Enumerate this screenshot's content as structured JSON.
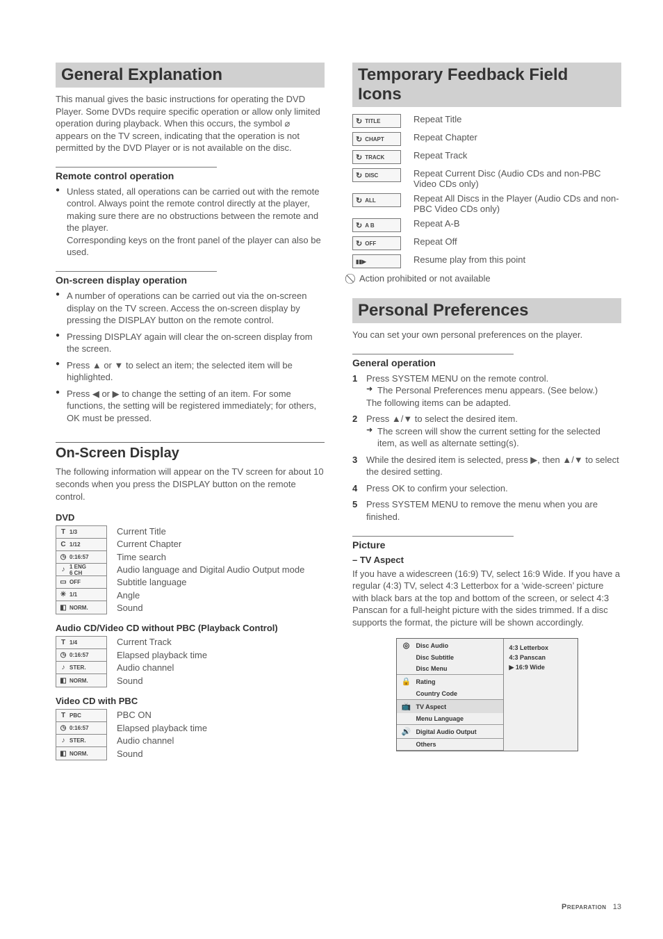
{
  "left": {
    "h1": "General Explanation",
    "intro": "This manual gives the basic instructions for operating the DVD Player. Some DVDs require specific operation or allow only limited operation during playback. When this occurs, the symbol ⌀ appears on the TV screen, indicating that the operation is not permitted by the DVD Player or is not available on the disc.",
    "remote_h": "Remote control operation",
    "remote_b1": "Unless stated, all operations can be carried out with the remote control. Always point the remote control directly at the player, making sure there are no obstructions between the remote and the player.",
    "remote_b1b": "Corresponding keys on the front panel of the player can also be used.",
    "osdop_h": "On-screen display operation",
    "osdop_b1": "A number of operations can be carried out via the on-screen display on the TV screen. Access the on-screen display by pressing the DISPLAY button on the remote control.",
    "osdop_b2": "Pressing DISPLAY again will clear the on-screen display from the screen.",
    "osdop_b3": "Press ▲ or ▼ to select an item; the selected item will be highlighted.",
    "osdop_b4": "Press ◀ or ▶ to change the setting of an item. For some functions, the setting will be registered immediately; for others, OK must be pressed.",
    "osd_h2": "On-Screen Display",
    "osd_intro": "The following information will appear on the TV screen for about 10 seconds when you press the DISPLAY button on the remote control.",
    "dvd_h": "DVD",
    "dvd_cells": [
      "1/3",
      "1/12",
      "0:16:57",
      "1 ENG\n6 CH",
      "OFF",
      "1/1",
      "NORM."
    ],
    "dvd_labels": [
      "Current Title",
      "Current Chapter",
      "Time search",
      "Audio language and Digital Audio Output mode",
      "Subtitle language",
      "Angle",
      "Sound"
    ],
    "acd_h": "Audio CD/Video CD without PBC (Playback Control)",
    "acd_cells": [
      "1/4",
      "0:16:57",
      "STER.",
      "NORM."
    ],
    "acd_labels": [
      "Current Track",
      "Elapsed playback time",
      "Audio channel",
      "Sound"
    ],
    "vcd_h": "Video CD with PBC",
    "vcd_cells": [
      "PBC",
      "0:16:57",
      "STER.",
      "NORM."
    ],
    "vcd_labels": [
      "PBC ON",
      "Elapsed playback time",
      "Audio channel",
      "Sound"
    ]
  },
  "right": {
    "h1": "Temporary Feedback Field Icons",
    "icons": [
      {
        "chip": "TITLE",
        "desc": "Repeat Title"
      },
      {
        "chip": "CHAPT",
        "desc": "Repeat Chapter"
      },
      {
        "chip": "TRACK",
        "desc": "Repeat Track"
      },
      {
        "chip": "DISC",
        "desc": "Repeat Current Disc (Audio CDs and non-PBC Video CDs only)"
      },
      {
        "chip": "ALL",
        "desc": "Repeat All Discs in the Player (Audio CDs and non-PBC Video CDs only)"
      },
      {
        "chip": "A  B",
        "desc": "Repeat A-B"
      },
      {
        "chip": "OFF",
        "desc": "Repeat Off"
      },
      {
        "chip": "▮▮▶",
        "desc": "Resume play from this point"
      }
    ],
    "prohibit": "Action prohibited or not available",
    "pp_h1": "Personal Preferences",
    "pp_intro": "You can set your own personal preferences on the player.",
    "gen_h": "General operation",
    "step1": "Press SYSTEM MENU on the remote control.",
    "step1b": "The Personal Preferences menu appears. (See below.)",
    "step1c": "The following items can be adapted.",
    "step2": "Press ▲/▼ to select the desired item.",
    "step2b": "The screen will show the current setting for the selected item, as well as alternate setting(s).",
    "step3": "While the desired item is selected, press ▶, then ▲/▼ to select the desired setting.",
    "step4": "Press OK to confirm your selection.",
    "step5": "Press SYSTEM MENU to remove the menu when you are finished.",
    "pic_h": "Picture",
    "tvaspect_h": "–   TV Aspect",
    "tvaspect_p": "If you have a widescreen (16:9) TV, select 16:9 Wide. If you have a regular (4:3) TV, select 4:3 Letterbox for a ‘wide-screen’ picture with black bars at the top and bottom of the screen, or select 4:3 Panscan for a full-height picture with the sides trimmed. If a disc supports the format, the picture will be shown accordingly.",
    "menu": {
      "left_items": [
        [
          "Disc Audio",
          "Disc Subtitle",
          "Disc Menu"
        ],
        [
          "Rating",
          "Country Code"
        ],
        [
          "TV Aspect",
          "Menu Language"
        ],
        [
          "Digital Audio Output"
        ],
        [
          "Others"
        ]
      ],
      "right_items": [
        "4:3 Letterbox",
        "4:3 Panscan",
        "▶ 16:9 Wide"
      ]
    }
  },
  "footer": {
    "section": "Preparation",
    "page": "13"
  },
  "icons": {
    "title": "T",
    "chapter": "C",
    "clock": "◷",
    "speaker": "♪",
    "subtitle": "▭",
    "angle": "✳",
    "sound": "◧",
    "repeat": "↻",
    "disc": "◎",
    "lock": "🔒",
    "tv": "📺",
    "aout": "🔊"
  }
}
